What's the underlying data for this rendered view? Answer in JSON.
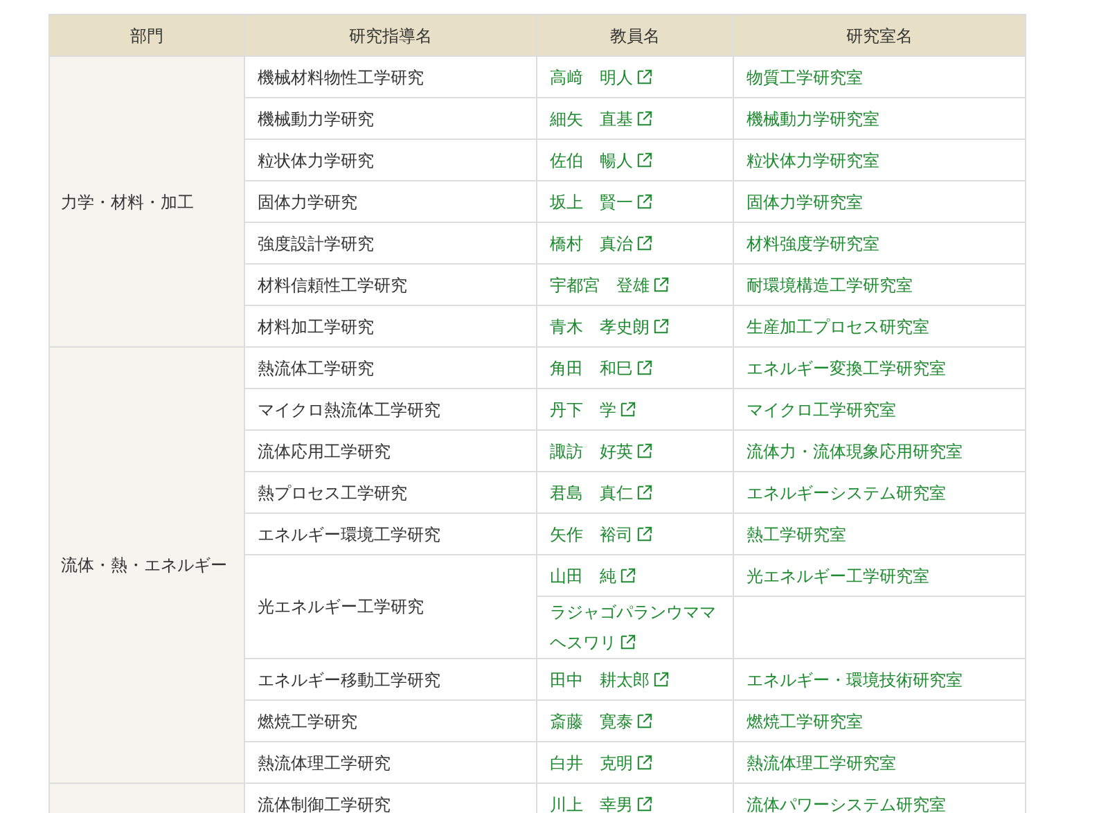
{
  "table": {
    "columns": [
      "部門",
      "研究指導名",
      "教員名",
      "研究室名"
    ],
    "departments": [
      {
        "name": "力学・材料・加工",
        "rows": [
          {
            "course": "機械材料物性工学研究",
            "staff": [
              {
                "name": "高﨑　明人",
                "lab": "物質工学研究室"
              }
            ]
          },
          {
            "course": "機械動力学研究",
            "staff": [
              {
                "name": "細矢　直基",
                "lab": "機械動力学研究室"
              }
            ]
          },
          {
            "course": "粒状体力学研究",
            "staff": [
              {
                "name": "佐伯　暢人",
                "lab": "粒状体力学研究室"
              }
            ]
          },
          {
            "course": "固体力学研究",
            "staff": [
              {
                "name": "坂上　賢一",
                "lab": "固体力学研究室"
              }
            ]
          },
          {
            "course": "強度設計学研究",
            "staff": [
              {
                "name": "橋村　真治",
                "lab": "材料強度学研究室"
              }
            ]
          },
          {
            "course": "材料信頼性工学研究",
            "staff": [
              {
                "name": "宇都宮　登雄",
                "lab": "耐環境構造工学研究室"
              }
            ]
          },
          {
            "course": "材料加工学研究",
            "staff": [
              {
                "name": "青木　孝史朗",
                "lab": "生産加工プロセス研究室"
              }
            ]
          }
        ]
      },
      {
        "name": "流体・熱・エネルギー",
        "rows": [
          {
            "course": "熱流体工学研究",
            "staff": [
              {
                "name": "角田　和巳",
                "lab": "エネルギー変換工学研究室"
              }
            ]
          },
          {
            "course": "マイクロ熱流体工学研究",
            "staff": [
              {
                "name": "丹下　学",
                "lab": "マイクロ工学研究室"
              }
            ]
          },
          {
            "course": "流体応用工学研究",
            "staff": [
              {
                "name": "諏訪　好英",
                "lab": "流体力・流体現象応用研究室"
              }
            ]
          },
          {
            "course": "熱プロセス工学研究",
            "staff": [
              {
                "name": "君島　真仁",
                "lab": "エネルギーシステム研究室"
              }
            ]
          },
          {
            "course": "エネルギー環境工学研究",
            "staff": [
              {
                "name": "矢作　裕司",
                "lab": "熱工学研究室"
              }
            ]
          },
          {
            "course": "光エネルギー工学研究",
            "staff": [
              {
                "name": "山田　純",
                "lab": "光エネルギー工学研究室"
              },
              {
                "name": "ラジャゴパランウママヘスワリ"
              }
            ]
          },
          {
            "course": "エネルギー移動工学研究",
            "staff": [
              {
                "name": "田中　耕太郎",
                "lab": "エネルギー・環境技術研究室"
              }
            ]
          },
          {
            "course": "燃焼工学研究",
            "staff": [
              {
                "name": "斎藤　寛泰",
                "lab": "燃焼工学研究室"
              }
            ]
          },
          {
            "course": "熱流体理工学研究",
            "staff": [
              {
                "name": "白井　克明",
                "lab": "熱流体理工学研究室"
              }
            ]
          }
        ]
      },
      {
        "rows": [
          {
            "course": "流体制御工学研究",
            "staff": [
              {
                "name": "川上　幸男",
                "lab": "流体パワーシステム研究室"
              }
            ]
          }
        ]
      }
    ]
  }
}
